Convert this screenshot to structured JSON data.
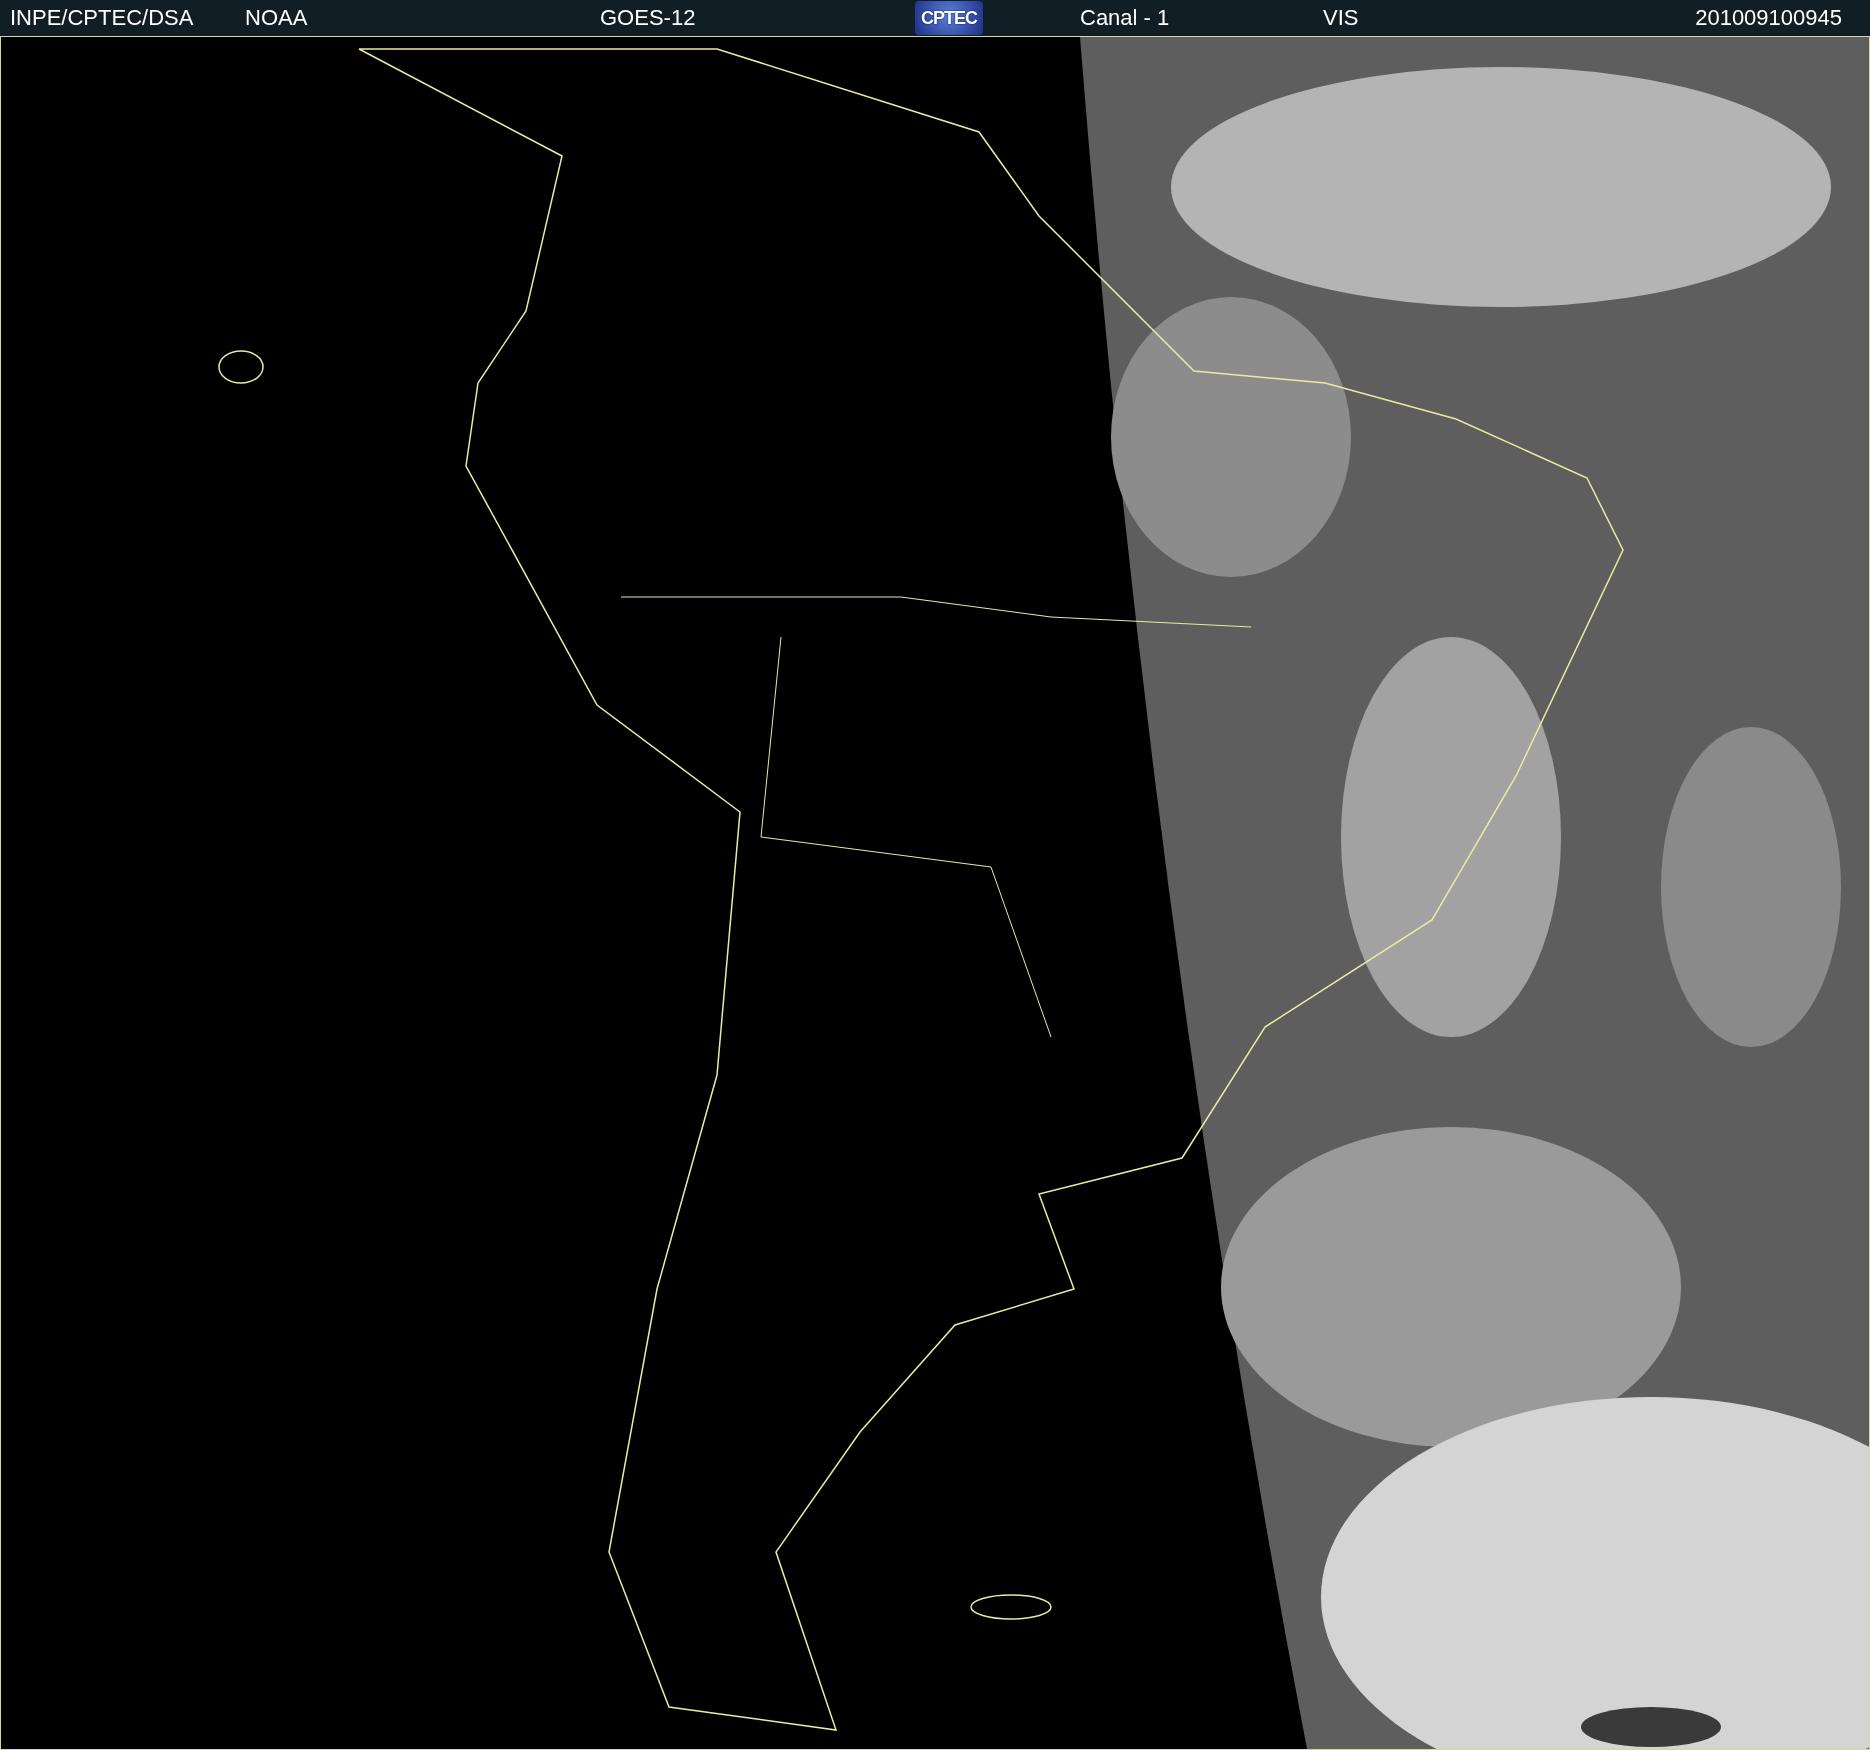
{
  "header": {
    "source": "INPE/CPTEC/DSA",
    "agency": "NOAA",
    "satellite": "GOES-12",
    "logo": "CPTEC",
    "channel": "Canal - 1",
    "band": "VIS",
    "timestamp": "201009100945"
  }
}
